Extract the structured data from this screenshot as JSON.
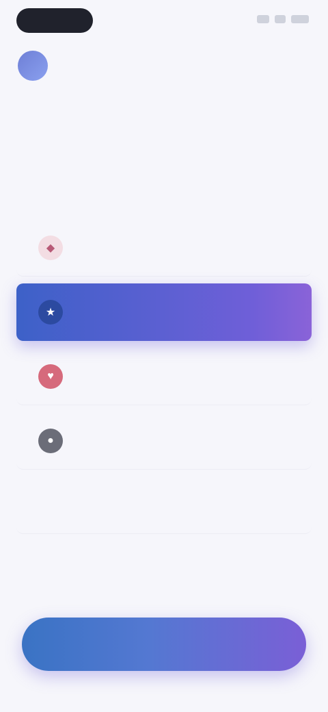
{
  "brand": {
    "name": ""
  },
  "page": {
    "title": "",
    "subtitle": ""
  },
  "options": [
    {
      "label": "",
      "icon": "gift-icon",
      "selected": false
    },
    {
      "label": "",
      "icon": "star-icon",
      "selected": true
    },
    {
      "label": "",
      "icon": "heart-icon",
      "selected": false
    },
    {
      "label": "",
      "icon": "user-icon",
      "selected": false
    },
    {
      "label": "",
      "icon": "other-icon",
      "selected": false
    }
  ],
  "actions": {
    "continue_label": ""
  },
  "colors": {
    "accent_start": "#3d61c8",
    "accent_end": "#8a63d8",
    "background": "#f6f6fb"
  }
}
